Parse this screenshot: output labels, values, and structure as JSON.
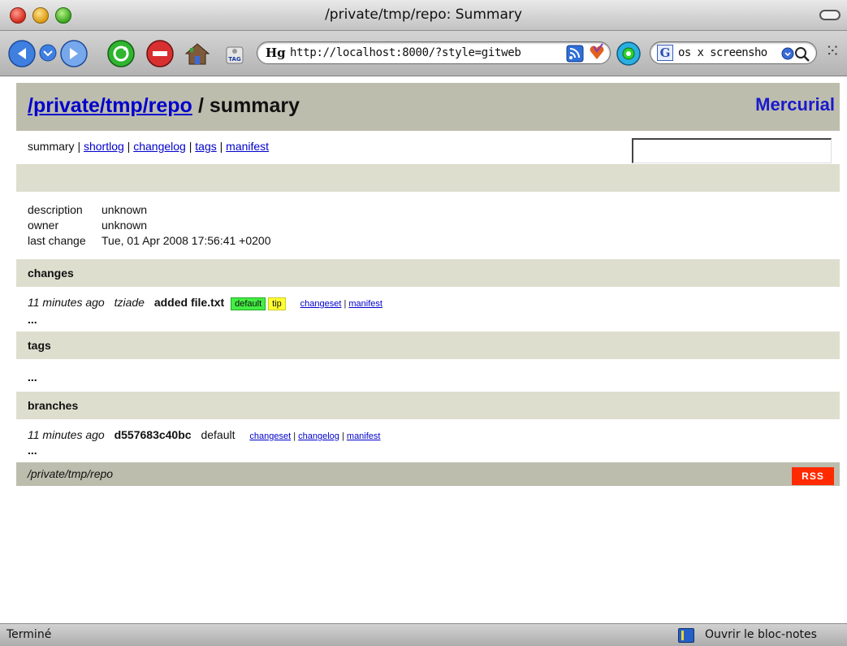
{
  "window": {
    "title": "/private/tmp/repo: Summary"
  },
  "toolbar": {
    "url_prefix": "Hg",
    "url": "http://localhost:8000/?style=gitweb",
    "search_engine_icon": "G",
    "search_text": "os x screensho"
  },
  "header": {
    "repo_link": "/private/tmp/repo",
    "page_name": " / summary",
    "brand": "Mercurial"
  },
  "nav": {
    "current": "summary",
    "sep": " | ",
    "links": [
      "shortlog",
      "changelog",
      "tags",
      "manifest"
    ]
  },
  "description": {
    "rows": [
      {
        "key": "description",
        "value": "unknown"
      },
      {
        "key": "owner",
        "value": "unknown"
      },
      {
        "key": "last change",
        "value": "Tue, 01 Apr 2008 17:56:41 +0200"
      }
    ]
  },
  "changes": {
    "title": "changes",
    "entry": {
      "age": "11 minutes ago",
      "author": "tziade",
      "desc": "added file.txt",
      "badges": [
        "default",
        "tip"
      ],
      "links": [
        "changeset",
        "manifest"
      ]
    },
    "more": "..."
  },
  "tags": {
    "title": "tags",
    "more": "..."
  },
  "branches": {
    "title": "branches",
    "entry": {
      "age": "11 minutes ago",
      "hash": "d557683c40bc",
      "name": "default",
      "links": [
        "changeset",
        "changelog",
        "manifest"
      ]
    },
    "more": "..."
  },
  "footer": {
    "path": "/private/tmp/repo",
    "rss": "RSS"
  },
  "status": {
    "left": "Terminé",
    "right": "Ouvrir le bloc-notes"
  },
  "colors": {
    "header_bg": "#bdbdae",
    "band_bg": "#dedecf",
    "link": "#0000cc",
    "badge_default": "#44ee44",
    "badge_tip": "#ffff33",
    "rss": "#ff2a00"
  }
}
